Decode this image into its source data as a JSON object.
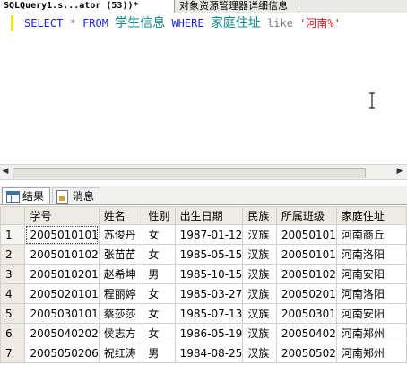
{
  "tabs": {
    "active": "SQLQuery1.s...ator (53))*",
    "inactive": "对象资源管理器详细信息"
  },
  "sql": {
    "select": "SELECT",
    "star": "*",
    "from": "FROM",
    "table": "学生信息",
    "where": "WHERE",
    "column": "家庭住址",
    "like": "like",
    "pattern": "'河南%'"
  },
  "results": {
    "tab_results": "结果",
    "tab_messages": "消息",
    "columns": [
      "学号",
      "姓名",
      "性别",
      "出生日期",
      "民族",
      "所属班级",
      "家庭住址"
    ],
    "rows": [
      [
        "1",
        "2005010101",
        "苏俊丹",
        "女",
        "1987-01-12",
        "汉族",
        "20050101",
        "河南商丘"
      ],
      [
        "2",
        "2005010102",
        "张苗苗",
        "女",
        "1985-05-15",
        "汉族",
        "20050101",
        "河南洛阳"
      ],
      [
        "3",
        "2005010201",
        "赵希坤",
        "男",
        "1985-10-15",
        "汉族",
        "20050102",
        "河南安阳"
      ],
      [
        "4",
        "2005020101",
        "程丽婷",
        "女",
        "1985-03-27",
        "汉族",
        "20050201",
        "河南洛阳"
      ],
      [
        "5",
        "2005030101",
        "蔡莎莎",
        "女",
        "1985-07-13",
        "汉族",
        "20050301",
        "河南安阳"
      ],
      [
        "6",
        "2005040202",
        "侯志方",
        "女",
        "1986-05-19",
        "汉族",
        "20050402",
        "河南郑州"
      ],
      [
        "7",
        "2005050206",
        "祝红涛",
        "男",
        "1984-08-25",
        "汉族",
        "20050502",
        "河南郑州"
      ]
    ]
  }
}
